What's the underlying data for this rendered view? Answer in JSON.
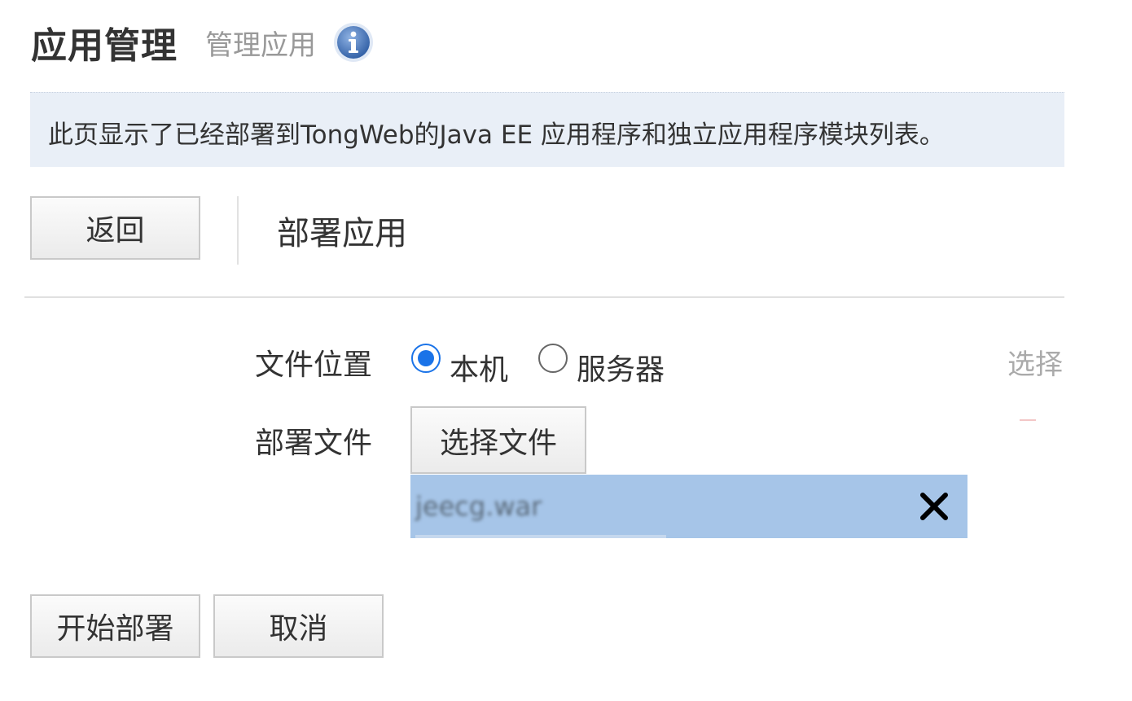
{
  "header": {
    "title": "应用管理",
    "subtitle": "管理应用",
    "info_icon": "info-circle-icon"
  },
  "banner": {
    "text": "此页显示了已经部署到TongWeb的Java EE 应用程序和独立应用程序模块列表。"
  },
  "toolbar": {
    "back_label": "返回",
    "section_title": "部署应用"
  },
  "form": {
    "location_label": "文件位置",
    "location_options": [
      {
        "label": "本机",
        "selected": true
      },
      {
        "label": "服务器",
        "selected": false
      }
    ],
    "cut_hint": "选择",
    "file_label": "部署文件",
    "choose_file_label": "选择文件",
    "selected_file": {
      "name": "jeecg.war",
      "remove_icon": "close-icon"
    }
  },
  "actions": {
    "start_label": "开始部署",
    "cancel_label": "取消"
  },
  "colors": {
    "banner_bg": "#e9eff7",
    "radio_accent": "#1a73e8",
    "file_highlight": "#a6c5e8",
    "info_icon": "#3f6fb5"
  }
}
